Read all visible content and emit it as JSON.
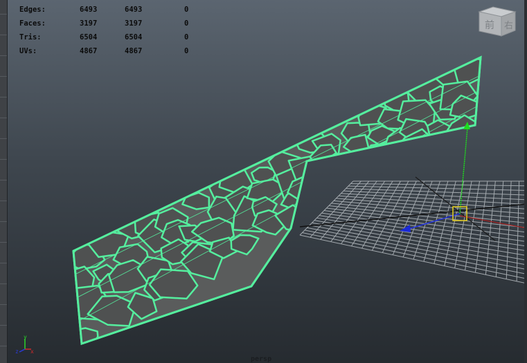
{
  "hud": {
    "rows": [
      {
        "label": "Edges:",
        "v1": "6493",
        "v2": "6493",
        "v3": "0"
      },
      {
        "label": "Faces:",
        "v1": "3197",
        "v2": "3197",
        "v3": "0"
      },
      {
        "label": "Tris:",
        "v1": "6504",
        "v2": "6504",
        "v3": "0"
      },
      {
        "label": "UVs:",
        "v1": "4867",
        "v2": "4867",
        "v3": "0"
      }
    ]
  },
  "viewcube": {
    "left_face": "前",
    "right_face": "右"
  },
  "axis_indicator": {
    "x": "x",
    "y": "y",
    "z": "z"
  },
  "camera_label": "persp",
  "colors": {
    "wire": "#55ee9e",
    "face": "#5a5c5c",
    "grid": "#9aa0a6",
    "manip_y": "#1fdc1f",
    "manip_z": "#2233dd",
    "pivot": "#e8d020"
  },
  "icons": {
    "manipulator": "move-manipulator-icon",
    "viewcube": "view-cube-icon",
    "axes": "axis-indicator-icon"
  }
}
